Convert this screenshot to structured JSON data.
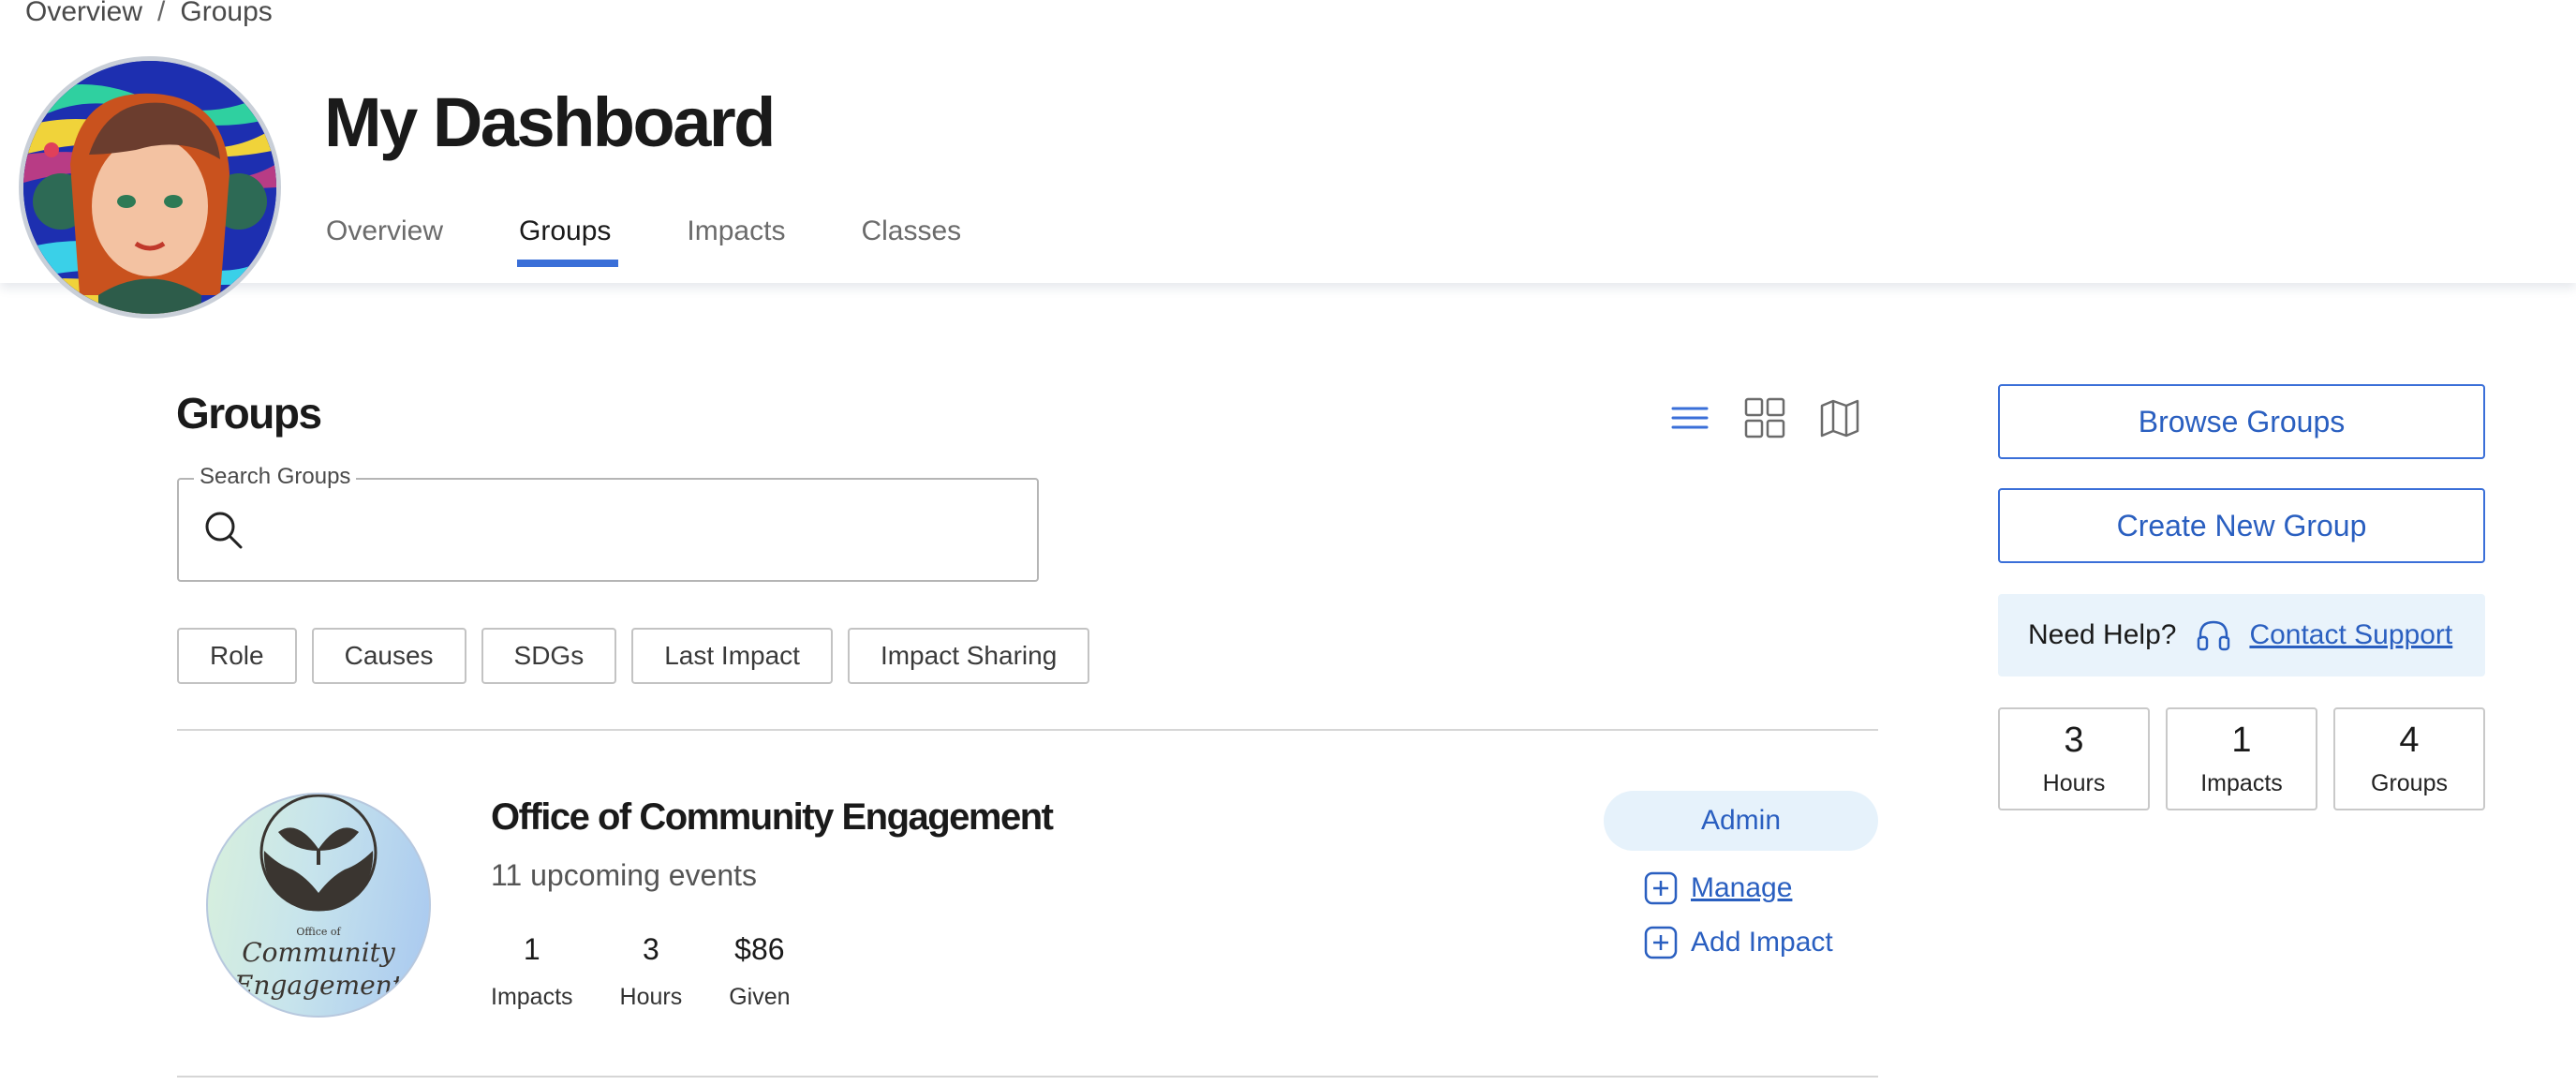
{
  "breadcrumb": {
    "items": [
      "Overview",
      "Groups"
    ],
    "separator": "/"
  },
  "header": {
    "title": "My Dashboard",
    "tabs": [
      {
        "label": "Overview",
        "active": false
      },
      {
        "label": "Groups",
        "active": true
      },
      {
        "label": "Impacts",
        "active": false
      },
      {
        "label": "Classes",
        "active": false
      }
    ]
  },
  "main": {
    "section_title": "Groups",
    "view_toggles": [
      {
        "icon": "list-view-icon",
        "active": true
      },
      {
        "icon": "grid-view-icon",
        "active": false
      },
      {
        "icon": "map-view-icon",
        "active": false
      }
    ],
    "search": {
      "label": "Search Groups",
      "value": "",
      "placeholder": ""
    },
    "filters": [
      "Role",
      "Causes",
      "SDGs",
      "Last Impact",
      "Impact Sharing"
    ],
    "groups": [
      {
        "name": "Office of Community Engagement",
        "events": "11 upcoming events",
        "logo": {
          "line1": "Office of",
          "line2": "Community",
          "line3": "Engagement"
        },
        "stats": [
          {
            "value": "1",
            "label": "Impacts"
          },
          {
            "value": "3",
            "label": "Hours"
          },
          {
            "value": "$86",
            "label": "Given"
          }
        ],
        "role": "Admin",
        "actions": {
          "manage": "Manage",
          "add_impact": "Add Impact"
        }
      }
    ]
  },
  "sidebar": {
    "browse_label": "Browse Groups",
    "create_label": "Create New Group",
    "help": {
      "label": "Need Help?",
      "link": "Contact Support"
    },
    "stats": [
      {
        "value": "3",
        "label": "Hours"
      },
      {
        "value": "1",
        "label": "Impacts"
      },
      {
        "value": "4",
        "label": "Groups"
      }
    ]
  },
  "colors": {
    "accent": "#3a6fd8",
    "link": "#2a5fc0",
    "badge_bg": "#e6f2fb",
    "help_bg": "#e9f3fb"
  }
}
